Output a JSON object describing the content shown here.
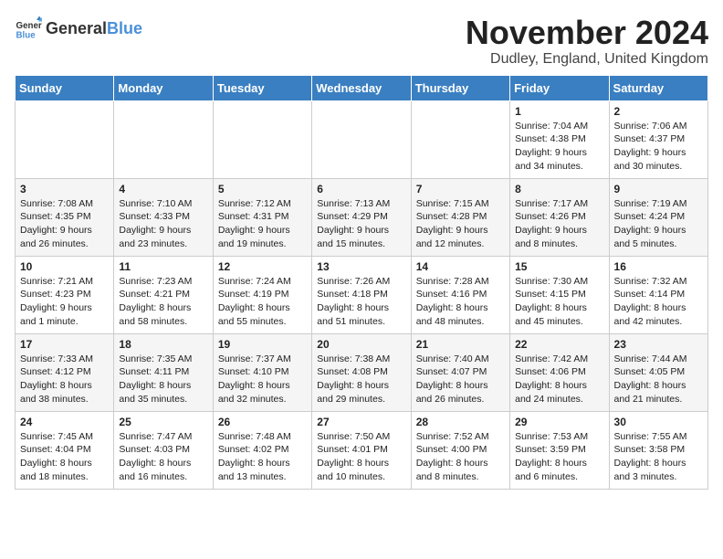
{
  "logo": {
    "text_general": "General",
    "text_blue": "Blue"
  },
  "title": "November 2024",
  "location": "Dudley, England, United Kingdom",
  "days_of_week": [
    "Sunday",
    "Monday",
    "Tuesday",
    "Wednesday",
    "Thursday",
    "Friday",
    "Saturday"
  ],
  "weeks": [
    [
      {
        "day": "",
        "info": ""
      },
      {
        "day": "",
        "info": ""
      },
      {
        "day": "",
        "info": ""
      },
      {
        "day": "",
        "info": ""
      },
      {
        "day": "",
        "info": ""
      },
      {
        "day": "1",
        "info": "Sunrise: 7:04 AM\nSunset: 4:38 PM\nDaylight: 9 hours\nand 34 minutes."
      },
      {
        "day": "2",
        "info": "Sunrise: 7:06 AM\nSunset: 4:37 PM\nDaylight: 9 hours\nand 30 minutes."
      }
    ],
    [
      {
        "day": "3",
        "info": "Sunrise: 7:08 AM\nSunset: 4:35 PM\nDaylight: 9 hours\nand 26 minutes."
      },
      {
        "day": "4",
        "info": "Sunrise: 7:10 AM\nSunset: 4:33 PM\nDaylight: 9 hours\nand 23 minutes."
      },
      {
        "day": "5",
        "info": "Sunrise: 7:12 AM\nSunset: 4:31 PM\nDaylight: 9 hours\nand 19 minutes."
      },
      {
        "day": "6",
        "info": "Sunrise: 7:13 AM\nSunset: 4:29 PM\nDaylight: 9 hours\nand 15 minutes."
      },
      {
        "day": "7",
        "info": "Sunrise: 7:15 AM\nSunset: 4:28 PM\nDaylight: 9 hours\nand 12 minutes."
      },
      {
        "day": "8",
        "info": "Sunrise: 7:17 AM\nSunset: 4:26 PM\nDaylight: 9 hours\nand 8 minutes."
      },
      {
        "day": "9",
        "info": "Sunrise: 7:19 AM\nSunset: 4:24 PM\nDaylight: 9 hours\nand 5 minutes."
      }
    ],
    [
      {
        "day": "10",
        "info": "Sunrise: 7:21 AM\nSunset: 4:23 PM\nDaylight: 9 hours\nand 1 minute."
      },
      {
        "day": "11",
        "info": "Sunrise: 7:23 AM\nSunset: 4:21 PM\nDaylight: 8 hours\nand 58 minutes."
      },
      {
        "day": "12",
        "info": "Sunrise: 7:24 AM\nSunset: 4:19 PM\nDaylight: 8 hours\nand 55 minutes."
      },
      {
        "day": "13",
        "info": "Sunrise: 7:26 AM\nSunset: 4:18 PM\nDaylight: 8 hours\nand 51 minutes."
      },
      {
        "day": "14",
        "info": "Sunrise: 7:28 AM\nSunset: 4:16 PM\nDaylight: 8 hours\nand 48 minutes."
      },
      {
        "day": "15",
        "info": "Sunrise: 7:30 AM\nSunset: 4:15 PM\nDaylight: 8 hours\nand 45 minutes."
      },
      {
        "day": "16",
        "info": "Sunrise: 7:32 AM\nSunset: 4:14 PM\nDaylight: 8 hours\nand 42 minutes."
      }
    ],
    [
      {
        "day": "17",
        "info": "Sunrise: 7:33 AM\nSunset: 4:12 PM\nDaylight: 8 hours\nand 38 minutes."
      },
      {
        "day": "18",
        "info": "Sunrise: 7:35 AM\nSunset: 4:11 PM\nDaylight: 8 hours\nand 35 minutes."
      },
      {
        "day": "19",
        "info": "Sunrise: 7:37 AM\nSunset: 4:10 PM\nDaylight: 8 hours\nand 32 minutes."
      },
      {
        "day": "20",
        "info": "Sunrise: 7:38 AM\nSunset: 4:08 PM\nDaylight: 8 hours\nand 29 minutes."
      },
      {
        "day": "21",
        "info": "Sunrise: 7:40 AM\nSunset: 4:07 PM\nDaylight: 8 hours\nand 26 minutes."
      },
      {
        "day": "22",
        "info": "Sunrise: 7:42 AM\nSunset: 4:06 PM\nDaylight: 8 hours\nand 24 minutes."
      },
      {
        "day": "23",
        "info": "Sunrise: 7:44 AM\nSunset: 4:05 PM\nDaylight: 8 hours\nand 21 minutes."
      }
    ],
    [
      {
        "day": "24",
        "info": "Sunrise: 7:45 AM\nSunset: 4:04 PM\nDaylight: 8 hours\nand 18 minutes."
      },
      {
        "day": "25",
        "info": "Sunrise: 7:47 AM\nSunset: 4:03 PM\nDaylight: 8 hours\nand 16 minutes."
      },
      {
        "day": "26",
        "info": "Sunrise: 7:48 AM\nSunset: 4:02 PM\nDaylight: 8 hours\nand 13 minutes."
      },
      {
        "day": "27",
        "info": "Sunrise: 7:50 AM\nSunset: 4:01 PM\nDaylight: 8 hours\nand 10 minutes."
      },
      {
        "day": "28",
        "info": "Sunrise: 7:52 AM\nSunset: 4:00 PM\nDaylight: 8 hours\nand 8 minutes."
      },
      {
        "day": "29",
        "info": "Sunrise: 7:53 AM\nSunset: 3:59 PM\nDaylight: 8 hours\nand 6 minutes."
      },
      {
        "day": "30",
        "info": "Sunrise: 7:55 AM\nSunset: 3:58 PM\nDaylight: 8 hours\nand 3 minutes."
      }
    ]
  ]
}
